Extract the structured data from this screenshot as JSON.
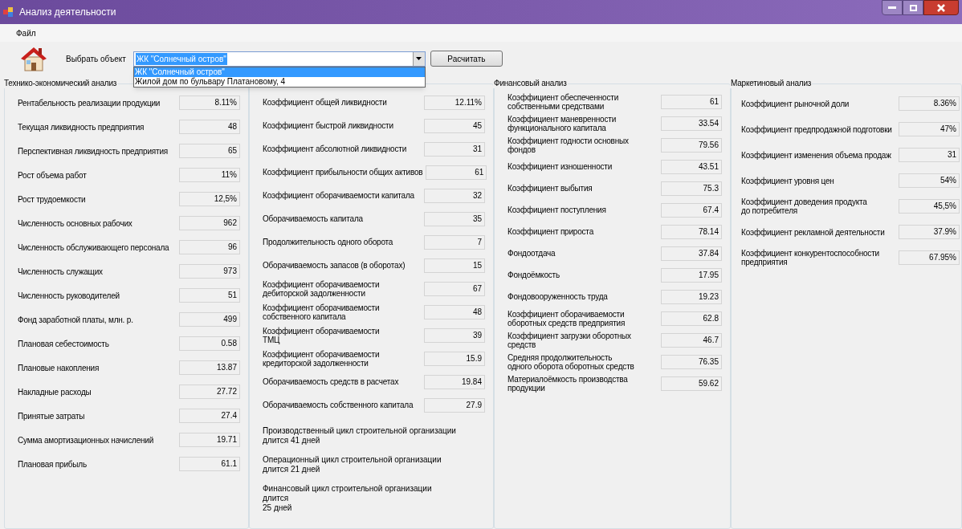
{
  "window": {
    "title": "Анализ деятельности"
  },
  "menu": [
    "Файл"
  ],
  "selector": {
    "label": "Выбрать объект",
    "value": "ЖК \"Солнечный остров\"",
    "expanded": true,
    "options": [
      {
        "label": "ЖК \"Солнечный остров\"",
        "selected": true
      },
      {
        "label": "Жилой дом по бульвару Платановому, 4",
        "selected": false
      }
    ]
  },
  "calculate_button": "Расчитать",
  "groups": [
    {
      "title": "Технико-экономический анализ",
      "rows": [
        {
          "label": "Рентабельность реализации продукции",
          "value": "8.11%"
        },
        {
          "label": "Текущая ликвидность предприятия",
          "value": "48"
        },
        {
          "label": "Перспективная ликвидность предприятия",
          "value": "65"
        },
        {
          "label": "Рост объема работ",
          "value": "11%"
        },
        {
          "label": "Рост трудоемкости",
          "value": "12,5%"
        },
        {
          "label": "Численность основных рабочих",
          "value": "962"
        },
        {
          "label": "Численность обслуживающего персонала",
          "value": "96"
        },
        {
          "label": "Численность служащих",
          "value": "973"
        },
        {
          "label": "Численность руководителей",
          "value": "51"
        },
        {
          "label": "Фонд заработной платы, млн. р.",
          "value": "499"
        },
        {
          "label": "Плановая себестоимость",
          "value": "0.58"
        },
        {
          "label": "Плановые накопления",
          "value": "13.87"
        },
        {
          "label": "Накладные расходы",
          "value": "27.72"
        },
        {
          "label": "Принятые затраты",
          "value": "27.4"
        },
        {
          "label": "Сумма амортизационных начислений",
          "value": "19.71"
        },
        {
          "label": "Плановая прибыль",
          "value": "61.1"
        }
      ]
    },
    {
      "rows": [
        {
          "label": "Коэффициент общей ликвидности",
          "value": "12.11%"
        },
        {
          "label": "Коэффициент быстрой ликвидности",
          "value": "45"
        },
        {
          "label": "Коэффициент абсолютной ликвидности",
          "value": "31"
        },
        {
          "label": "Коэффициент прибыльности общих активов",
          "value": "61"
        },
        {
          "label": "Коэффициент оборачиваемости капитала",
          "value": "32"
        },
        {
          "label": "Оборачиваемость капитала",
          "value": "35"
        },
        {
          "label": "Продолжительность одного оборота",
          "value": "7"
        },
        {
          "label": "Оборачиваемость запасов (в оборотах)",
          "value": "15"
        },
        {
          "label": "Коэффициент оборачиваемости\nдебиторской задолженности",
          "value": "67"
        },
        {
          "label": "Коэффициент оборачиваемости\nсобственного капитала",
          "value": "48"
        },
        {
          "label": "Коэффициент оборачиваемости\nТМЦ",
          "value": "39"
        },
        {
          "label": "Коэффициент оборачиваемости\nкредиторской задолженности",
          "value": "15.9"
        },
        {
          "label": "Оборачиваемость средств в расчетах",
          "value": "19.84"
        },
        {
          "label": "Оборачиваемость собственного капитала",
          "value": "27.9"
        }
      ],
      "notes": [
        "Производственный цикл строительной организации\nдлится 41 дней",
        "Операционный цикл строительной организации\nдлится 21 дней",
        "Финансовый цикл строительной организации\nдлится\n25 дней"
      ]
    },
    {
      "title": "Финансовый анализ",
      "rows": [
        {
          "label": "Коэффициент обеспеченности\nсобственными средствами",
          "value": "61"
        },
        {
          "label": "Коэффициент маневренности\nфункционального капитала",
          "value": "33.54"
        },
        {
          "label": "Коэффициент годности основных\nфондов",
          "value": "79.56"
        },
        {
          "label": "Коэффициент изношенности",
          "value": "43.51"
        },
        {
          "label": "Коэффициент выбытия",
          "value": "75.3"
        },
        {
          "label": "Коэффициент поступления",
          "value": "67.4"
        },
        {
          "label": "Коэффициент прироста",
          "value": "78.14"
        },
        {
          "label": "Фондоотдача",
          "value": "37.84"
        },
        {
          "label": "Фондоёмкость",
          "value": "17.95"
        },
        {
          "label": "Фондовооруженность труда",
          "value": "19.23"
        },
        {
          "label": "Коэффициент оборачиваемости\nоборотных средств предприятия",
          "value": "62.8"
        },
        {
          "label": "Коэффициент загрузки оборотных\nсредств",
          "value": "46.7"
        },
        {
          "label": "Средняя продолжительность\nодного оборота оборотных средств",
          "value": "76.35"
        },
        {
          "label": "Материалоёмкость производства\nпродукции",
          "value": "59.62"
        }
      ]
    },
    {
      "title": "Маркетиновый анализ",
      "rows": [
        {
          "label": "Коэффициент рыночной доли",
          "value": "8.36%"
        },
        {
          "label": "Коэффициент предпродажной подготовки",
          "value": "47%"
        },
        {
          "label": "Коэффициент изменения объема продаж",
          "value": "31"
        },
        {
          "label": "Коэффициент уровня цен",
          "value": "54%"
        },
        {
          "label": "Коэффициент доведения продукта\nдо потребителя",
          "value": "45,5%"
        },
        {
          "label": "Коэффициент рекламной деятельности",
          "value": "37.9%"
        },
        {
          "label": "Коэффициент конкурентоспособности\nпредприятия",
          "value": "67.95%"
        }
      ]
    }
  ]
}
